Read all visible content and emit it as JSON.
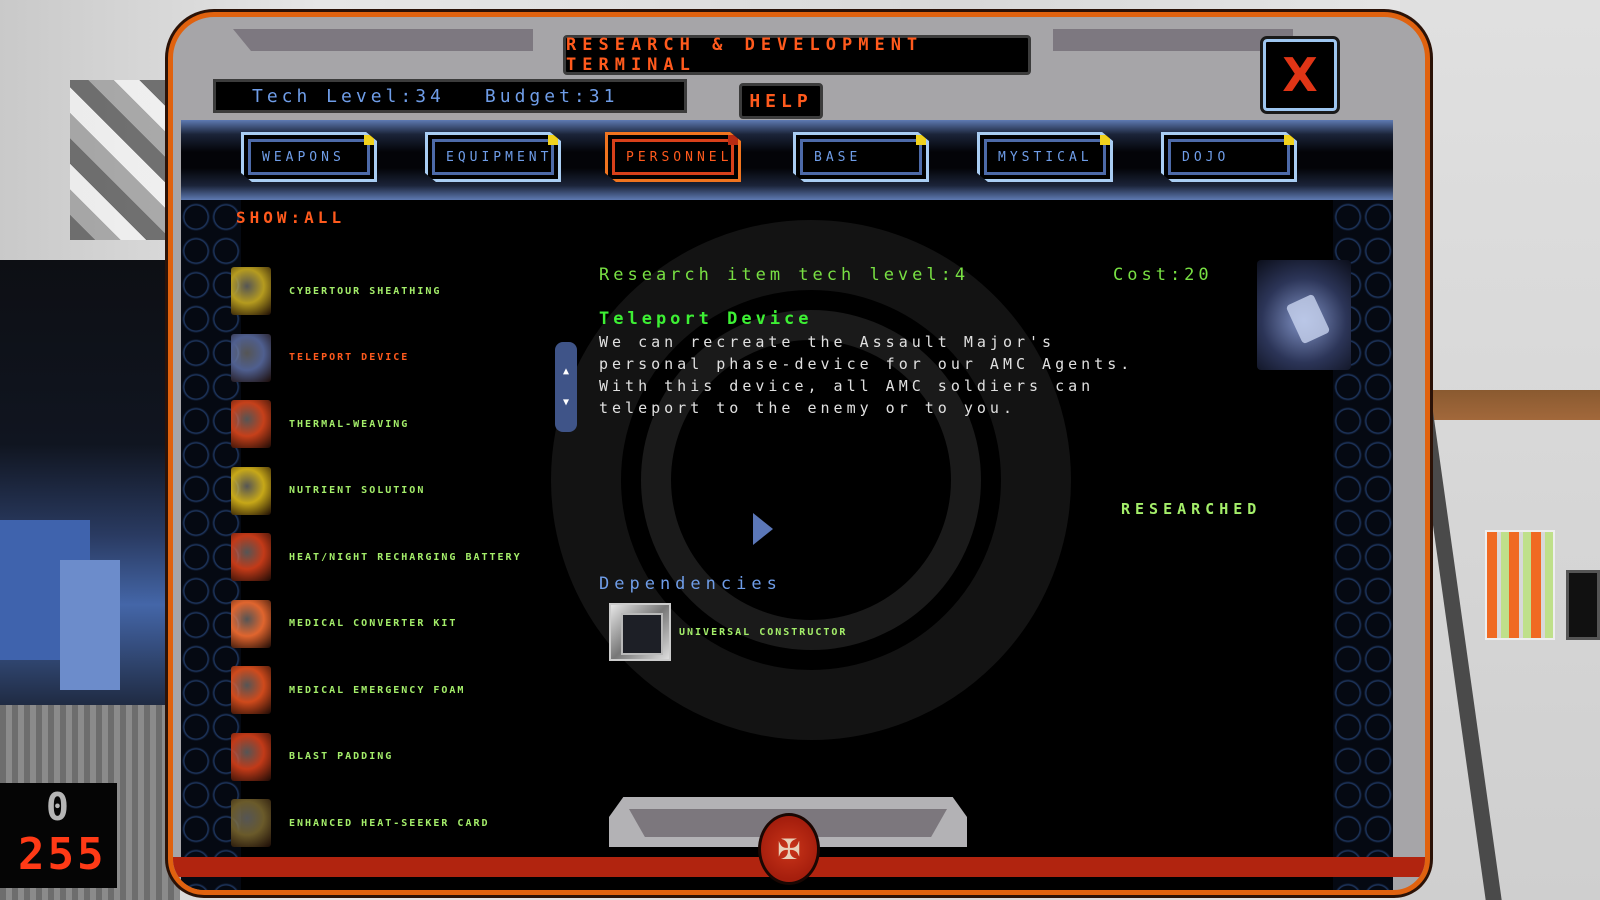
{
  "window": {
    "title": "RESEARCH & DEVELOPMENT TERMINAL",
    "help_label": "HELP",
    "close_label": "X"
  },
  "stats": {
    "tech_level_label": "Tech Level:",
    "tech_level_value": "34",
    "budget_label": "Budget:",
    "budget_value": "31"
  },
  "tabs": [
    {
      "label": "WEAPONS",
      "active": false
    },
    {
      "label": "EQUIPMENT",
      "active": false
    },
    {
      "label": "PERSONNEL",
      "active": true
    },
    {
      "label": "BASE",
      "active": false
    },
    {
      "label": "MYSTICAL",
      "active": false
    },
    {
      "label": "DOJO",
      "active": false
    }
  ],
  "filter": {
    "label": "SHOW:",
    "value": "ALL"
  },
  "items": [
    {
      "label": "CYBERTOUR SHEATHING",
      "icon": "armor-icon",
      "color": "#b59b1f",
      "selected": false
    },
    {
      "label": "TELEPORT DEVICE",
      "icon": "teleport-device-icon",
      "color": "#4f5f8f",
      "selected": true
    },
    {
      "label": "THERMAL-WEAVING",
      "icon": "thermal-weaving-icon",
      "color": "#c6401a",
      "selected": false
    },
    {
      "label": "NUTRIENT SOLUTION",
      "icon": "flask-icon",
      "color": "#c7a818",
      "selected": false
    },
    {
      "label": "HEAT/NIGHT RECHARGING BATTERY",
      "icon": "battery-icon",
      "color": "#c33a18",
      "selected": false
    },
    {
      "label": "MEDICAL CONVERTER KIT",
      "icon": "medical-kit-icon",
      "color": "#e0652e",
      "selected": false
    },
    {
      "label": "MEDICAL EMERGENCY FOAM",
      "icon": "foam-canister-icon",
      "color": "#cf4a1c",
      "selected": false
    },
    {
      "label": "BLAST PADDING",
      "icon": "padding-icon",
      "color": "#c23a18",
      "selected": false
    },
    {
      "label": "ENHANCED HEAT-SEEKER CARD",
      "icon": "card-icon",
      "color": "#6a5a2a",
      "selected": false
    }
  ],
  "detail": {
    "tech_level_text": "Research item tech level:4",
    "cost_text": "Cost:20",
    "name": "Teleport Device",
    "description": "We can recreate the Assault Major's personal phase-device for our AMC Agents. With this device, all AMC soldiers can teleport to the enemy or to you.",
    "status": "RESEARCHED",
    "dependencies_title": "Dependencies",
    "dependencies": [
      {
        "label": "UNIVERSAL CONSTRUCTOR",
        "icon": "constructor-icon"
      }
    ]
  },
  "scroll": {
    "up": "▲",
    "down": "▼"
  },
  "hud": {
    "top_value": "0",
    "bottom_value": "255"
  },
  "tray": {
    "logo_glyph": "✠"
  }
}
